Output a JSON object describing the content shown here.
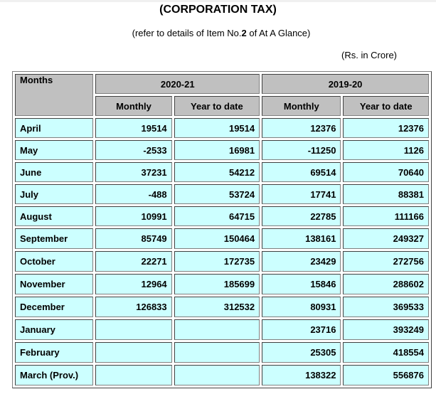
{
  "title": "(CORPORATION TAX)",
  "subtitle_prefix": "(refer to details of Item No.",
  "subtitle_item": "2",
  "subtitle_suffix": " of At A Glance)",
  "unit": "(Rs. in Crore)",
  "table": {
    "months_header": "Months",
    "year_groups": [
      "2020-21",
      "2019-20"
    ],
    "sub_headers": [
      "Monthly",
      "Year to date",
      "Monthly",
      "Year to date"
    ],
    "rows": [
      {
        "month": "April",
        "values": [
          "19514",
          "19514",
          "12376",
          "12376"
        ]
      },
      {
        "month": "May",
        "values": [
          "-2533",
          "16981",
          "-11250",
          "1126"
        ]
      },
      {
        "month": "June",
        "values": [
          "37231",
          "54212",
          "69514",
          "70640"
        ]
      },
      {
        "month": "July",
        "values": [
          "-488",
          "53724",
          "17741",
          "88381"
        ]
      },
      {
        "month": "August",
        "values": [
          "10991",
          "64715",
          "22785",
          "111166"
        ]
      },
      {
        "month": "September",
        "values": [
          "85749",
          "150464",
          "138161",
          "249327"
        ]
      },
      {
        "month": "October",
        "values": [
          "22271",
          "172735",
          "23429",
          "272756"
        ]
      },
      {
        "month": "November",
        "values": [
          "12964",
          "185699",
          "15846",
          "288602"
        ]
      },
      {
        "month": "December",
        "values": [
          "126833",
          "312532",
          "80931",
          "369533"
        ]
      },
      {
        "month": "January",
        "values": [
          "",
          "",
          "23716",
          "393249"
        ]
      },
      {
        "month": "February",
        "values": [
          "",
          "",
          "25305",
          "418554"
        ]
      },
      {
        "month": "March (Prov.)",
        "values": [
          "",
          "",
          "138322",
          "556876"
        ]
      }
    ]
  }
}
